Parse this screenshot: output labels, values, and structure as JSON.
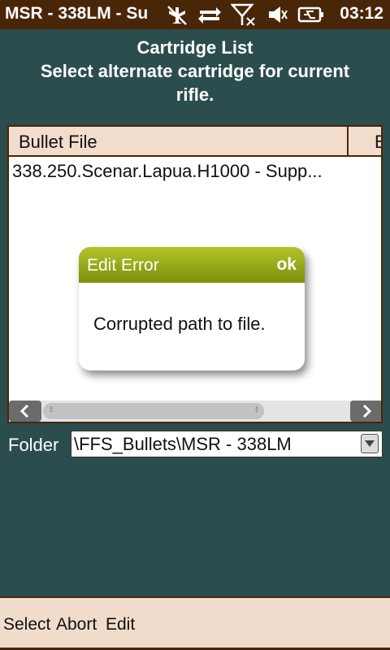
{
  "status_bar": {
    "title": "MSR - 338LM - Su",
    "time": "03:12",
    "icons": [
      "airplane-mode-icon",
      "data-sync-icon",
      "no-signal-icon",
      "speaker-muted-icon",
      "battery-charging-icon"
    ]
  },
  "header": {
    "title": "Cartridge List",
    "subtitle_line1": "Select alternate cartridge for current",
    "subtitle_line2": "rifle."
  },
  "list": {
    "columns": [
      "Bullet File",
      "B"
    ],
    "rows": [
      {
        "bullet_file": "338.250.Scenar.Lapua.H1000 - Supp..."
      }
    ]
  },
  "dialog": {
    "title": "Edit Error",
    "ok_label": "ok",
    "message": "Corrupted path to file."
  },
  "folder": {
    "label": "Folder",
    "value": "\\FFS_Bullets\\MSR - 338LM"
  },
  "menu": {
    "select": "Select",
    "abort": "Abort",
    "edit": "Edit"
  },
  "colors": {
    "background": "#2c4d4d",
    "status_bar": "#4a2608",
    "dialog_header": "#97aa1a",
    "menu_bar": "#f0dccb"
  }
}
